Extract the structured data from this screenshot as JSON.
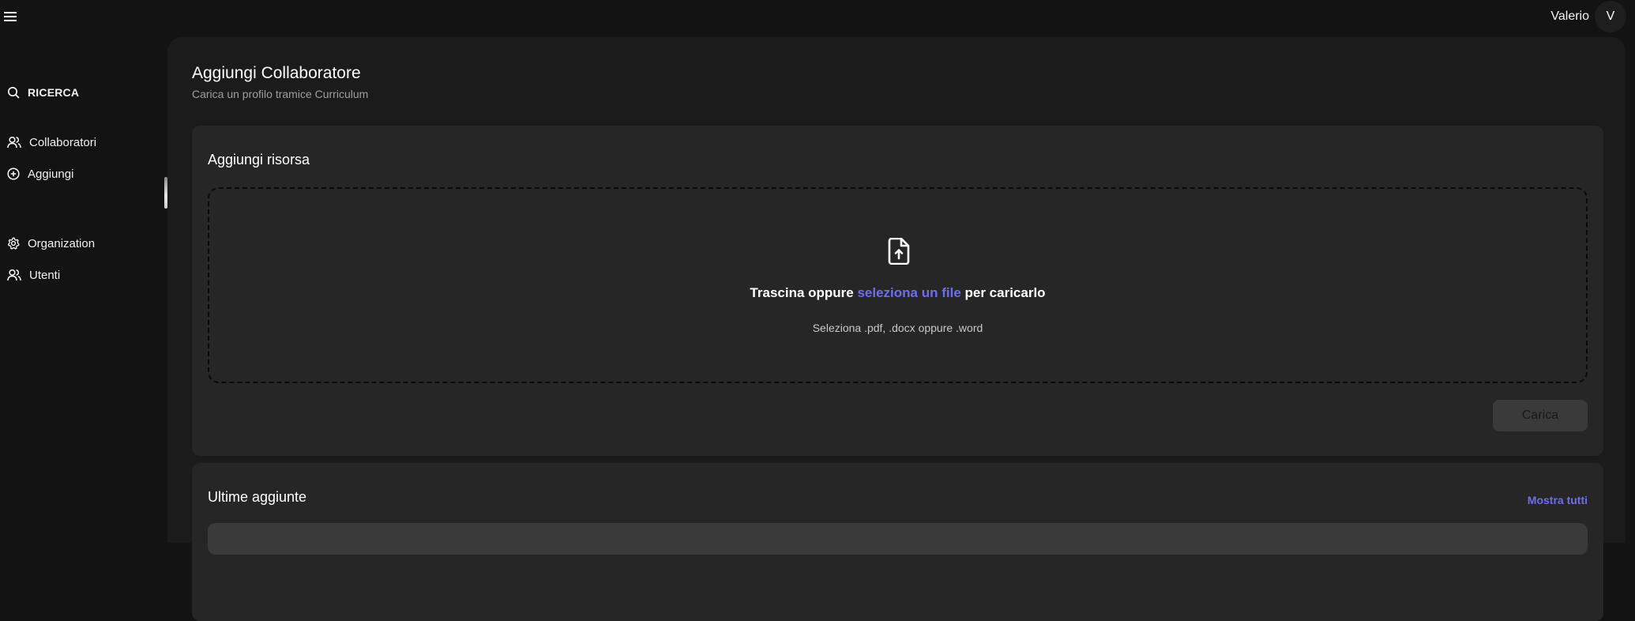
{
  "header": {
    "user_name": "Valerio",
    "avatar_initial": "V",
    "menu_icon": "hamburger-icon"
  },
  "sidebar": {
    "items": [
      {
        "label": "RICERCA",
        "icon": "search-icon"
      },
      {
        "label": "Collaboratori",
        "icon": "users-icon"
      },
      {
        "label": "Aggiungi",
        "icon": "plus-circle-icon",
        "active": true
      },
      {
        "label": "Organization",
        "icon": "gear-icon"
      },
      {
        "label": "Utenti",
        "icon": "users-icon"
      }
    ]
  },
  "main": {
    "title": "Aggiungi Collaboratore",
    "subtitle": "Carica un profilo tramice Curriculum",
    "upload_card": {
      "title": "Aggiungi risorsa",
      "drop_text_before": "Trascina oppure ",
      "drop_link": "seleziona un file",
      "drop_text_after": " per caricarlo",
      "hint": "Seleziona .pdf, .docx oppure .word",
      "icon": "file-upload-icon",
      "button_label": "Carica"
    },
    "recent_card": {
      "title": "Ultime aggiunte",
      "show_all": "Mostra tutti"
    }
  },
  "colors": {
    "background": "#131313",
    "panel": "#1b1b1b",
    "card": "#262626",
    "accent": "#6d6df0"
  }
}
